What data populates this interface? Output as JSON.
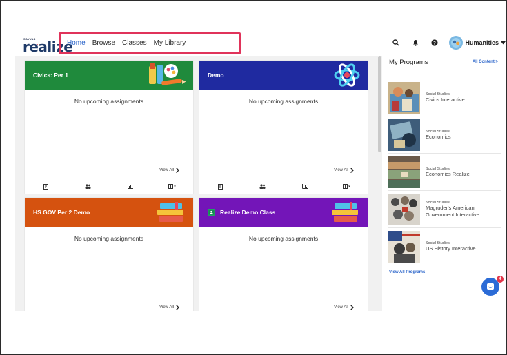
{
  "brand": {
    "company": "SAVVAS",
    "product": "realize"
  },
  "nav": {
    "items": [
      {
        "label": "Home",
        "active": true
      },
      {
        "label": "Browse",
        "active": false
      },
      {
        "label": "Classes",
        "active": false
      },
      {
        "label": "My Library",
        "active": false
      }
    ],
    "highlight_color": "#e0335a"
  },
  "header_right": {
    "icons": [
      "search-icon",
      "bell-icon",
      "help-icon"
    ],
    "user_label": "Humanities"
  },
  "classes": [
    {
      "name": "Civics: Per 1",
      "color": "#1f8a3c",
      "empty_text": "No upcoming assignments",
      "view_all": "View All",
      "art": "art-supplies-icon"
    },
    {
      "name": "Demo",
      "color": "#1f2aa0",
      "empty_text": "No upcoming assignments",
      "view_all": "View All",
      "art": "atom-icon"
    },
    {
      "name": "HS GOV Per 2 Demo",
      "color": "#d5520f",
      "empty_text": "No upcoming assignments",
      "view_all": "View All",
      "art": "books-icon"
    },
    {
      "name": "Realize Demo Class",
      "color": "#7315b8",
      "empty_text": "No upcoming assignments",
      "view_all": "View All",
      "art": "books-icon"
    }
  ],
  "card_footer_icons": [
    "assignments-icon",
    "students-icon",
    "data-icon",
    "layout-icon"
  ],
  "sidebar": {
    "title": "My Programs",
    "all_content": "All Content >",
    "programs": [
      {
        "category": "Social Studies",
        "title_lines": [
          "Civics Interactive"
        ]
      },
      {
        "category": "Social Studies",
        "title_lines": [
          "Economics"
        ]
      },
      {
        "category": "Social Studies",
        "title_lines": [
          "Economics Realize"
        ]
      },
      {
        "category": "Social Studies",
        "title_lines": [
          "Magruder's American",
          "Government Interactive"
        ]
      },
      {
        "category": "Social Studies",
        "title_lines": [
          "US History Interactive"
        ]
      }
    ],
    "view_all_programs": "View All Programs"
  },
  "chat": {
    "badge": "4"
  }
}
